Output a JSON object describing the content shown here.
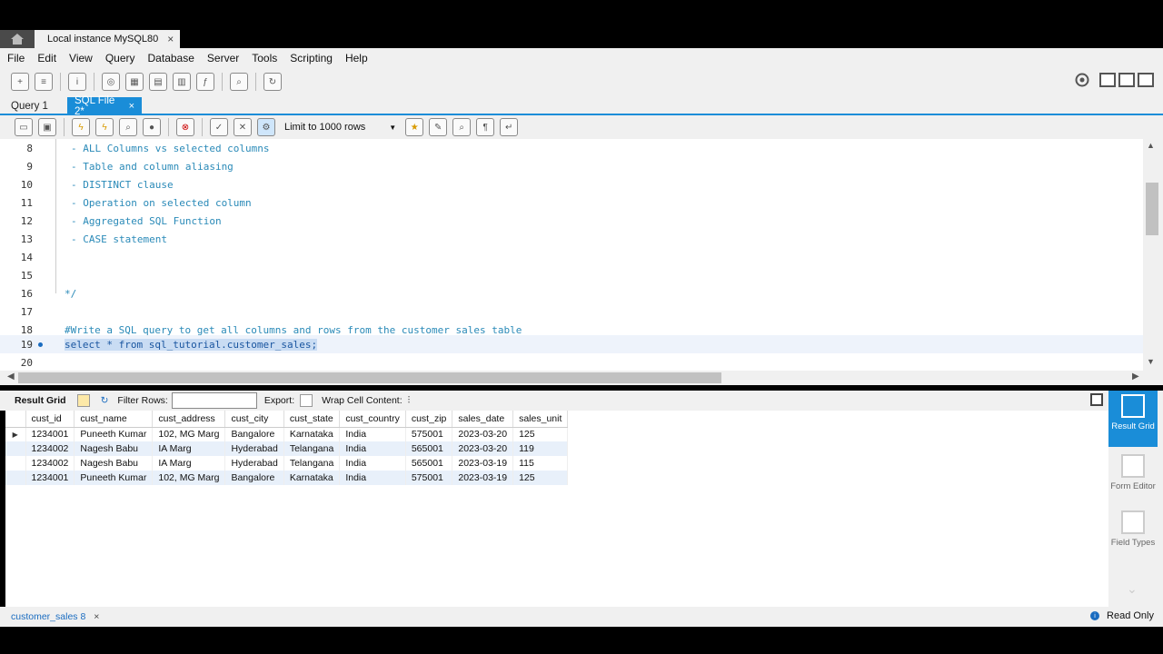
{
  "window": {
    "connection_tab": "Local instance MySQL80",
    "close_glyph": "×"
  },
  "menu": [
    "File",
    "Edit",
    "View",
    "Query",
    "Database",
    "Server",
    "Tools",
    "Scripting",
    "Help"
  ],
  "query_tabs": [
    {
      "label": "Query 1",
      "active": false
    },
    {
      "label": "SQL File 2*",
      "active": true
    }
  ],
  "editor_toolbar": {
    "limit_label": "Limit to 1000 rows"
  },
  "editor": {
    "lines": [
      {
        "num": "8",
        "text": "- ALL Columns vs selected columns",
        "kind": "cmt"
      },
      {
        "num": "9",
        "text": "- Table and column aliasing",
        "kind": "cmt"
      },
      {
        "num": "10",
        "text": "- DISTINCT clause",
        "kind": "cmt"
      },
      {
        "num": "11",
        "text": "- Operation on selected column",
        "kind": "cmt"
      },
      {
        "num": "12",
        "text": "- Aggregated SQL Function",
        "kind": "cmt"
      },
      {
        "num": "13",
        "text": "- CASE statement",
        "kind": "cmt"
      },
      {
        "num": "14",
        "text": "",
        "kind": "cmt"
      },
      {
        "num": "15",
        "text": "",
        "kind": "cmt"
      },
      {
        "num": "16",
        "text": "*/",
        "kind": "cmt"
      },
      {
        "num": "17",
        "text": "",
        "kind": "cmt"
      },
      {
        "num": "18",
        "text": "#Write a SQL query to get all columns and rows from the customer_sales table",
        "kind": "cmt"
      },
      {
        "num": "19",
        "text": "select * from sql_tutorial.customer_sales;",
        "kind": "sel"
      },
      {
        "num": "20",
        "text": "",
        "kind": "cmt"
      }
    ]
  },
  "result_toolbar": {
    "result_grid": "Result Grid",
    "filter_rows": "Filter Rows:",
    "export": "Export:",
    "wrap": "Wrap Cell Content:"
  },
  "grid": {
    "columns": [
      "cust_id",
      "cust_name",
      "cust_address",
      "cust_city",
      "cust_state",
      "cust_country",
      "cust_zip",
      "sales_date",
      "sales_unit"
    ],
    "rows": [
      [
        "1234001",
        "Puneeth Kumar",
        "102, MG Marg",
        "Bangalore",
        "Karnataka",
        "India",
        "575001",
        "2023-03-20",
        "125"
      ],
      [
        "1234002",
        "Nagesh Babu",
        "IA Marg",
        "Hyderabad",
        "Telangana",
        "India",
        "565001",
        "2023-03-20",
        "119"
      ],
      [
        "1234002",
        "Nagesh Babu",
        "IA Marg",
        "Hyderabad",
        "Telangana",
        "India",
        "565001",
        "2023-03-19",
        "115"
      ],
      [
        "1234001",
        "Puneeth Kumar",
        "102, MG Marg",
        "Bangalore",
        "Karnataka",
        "India",
        "575001",
        "2023-03-19",
        "125"
      ]
    ]
  },
  "side_panel": {
    "result_grid": "Result Grid",
    "form_editor": "Form Editor",
    "field_types": "Field Types"
  },
  "status": {
    "tab": "customer_sales 8",
    "read_only": "Read Only"
  },
  "colors": {
    "accent": "#1a8dd8",
    "comment": "#2a8ab8",
    "selection": "#c9dcf3"
  }
}
